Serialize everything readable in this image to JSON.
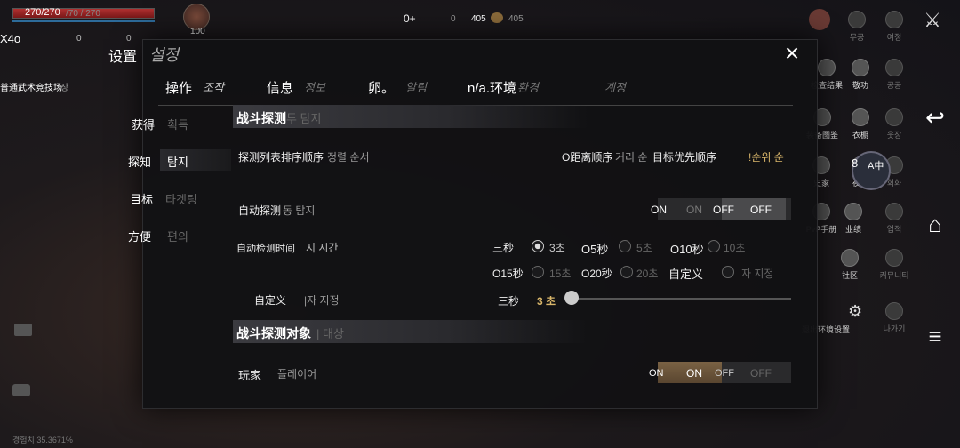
{
  "hud": {
    "hp_text": "270/270",
    "mp_text": "/70 / 270",
    "hp_fraction": 1.0,
    "multiplier": "X4o",
    "zero1": "0",
    "zero2": "0",
    "level": "100",
    "location": "普通武术竞技场",
    "location_suffix": "장",
    "currency": {
      "a": "0+",
      "b": "0",
      "c": "405",
      "d": "405"
    },
    "exp_text": "경험치 35.3671%"
  },
  "right_panel": {
    "row1": [
      "무공",
      "여정"
    ],
    "row2": [
      "检查结果",
      "敬功",
      "공공"
    ],
    "row3": [
      "装备图鉴",
      "衣橱",
      "웃장"
    ],
    "row4": [
      "史家",
      "夜话",
      "회화"
    ],
    "row5": [
      "PvP手册",
      "业绩",
      "업적"
    ],
    "row6": [
      "社区",
      "커뮤니티"
    ],
    "row7": [
      "退出环境设置",
      "나가기"
    ],
    "translate_badge": {
      "num": "8",
      "label": "A中"
    }
  },
  "dialog": {
    "title": "设置",
    "title_ko": "설정",
    "close_icon": "×",
    "tabs": [
      {
        "label": "操作",
        "ko": "조작"
      },
      {
        "label": "信息",
        "ko": "정보"
      },
      {
        "label": "卵。",
        "ko": "알림"
      },
      {
        "label": "n/a.环境",
        "ko": "환경"
      },
      {
        "label": "",
        "ko": "계정"
      }
    ],
    "sidebar": [
      {
        "label": "获得",
        "ko": "획득"
      },
      {
        "label": "探知",
        "ko": "탐지"
      },
      {
        "label": "目标",
        "ko": "타겟팅"
      },
      {
        "label": "方便",
        "ko": "편의"
      }
    ],
    "section1": {
      "title": "战斗探测",
      "ko": "투 탐지"
    },
    "sort_row": {
      "label": "探测列表排序顺序",
      "ko": "정렬 순서",
      "opt1": "O距离顺序",
      "opt1_ko": "거리 순",
      "opt2": "目标优先顺序",
      "opt2_ko": "!순위 순"
    },
    "auto_detect": {
      "label": "自动探测",
      "ko": "동 탐지",
      "on_label": "ON",
      "on_ko": "ON",
      "off_label": "OFF",
      "off_ko": "OFF"
    },
    "auto_time": {
      "label": "自动检测时间",
      "ko": "지 시간",
      "options": [
        {
          "label": "三秒",
          "ko": "3초"
        },
        {
          "label": "O5秒",
          "ko": "5초"
        },
        {
          "label": "O10秒",
          "ko": "10초"
        },
        {
          "label": "O15秒",
          "ko": "15초"
        },
        {
          "label": "O20秒",
          "ko": "20초"
        },
        {
          "label": "自定义",
          "ko": "자 지정"
        }
      ]
    },
    "custom": {
      "label": "自定义",
      "ko": "|자 지정",
      "value_label": "三秒",
      "value_ko": "3 초"
    },
    "section2": {
      "title": "战斗探测对象",
      "ko": "| 대상"
    },
    "player": {
      "label": "玩家",
      "ko": "플레이어",
      "on_label": "ON",
      "on_ko": "ON",
      "off_label": "OFF",
      "off_ko": "OFF"
    }
  }
}
